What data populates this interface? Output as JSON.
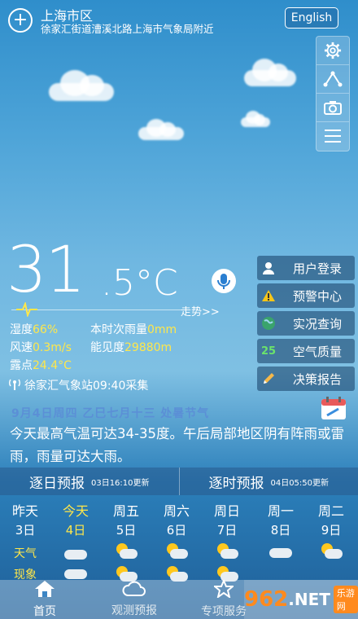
{
  "header": {
    "city": "上海市区",
    "address": "徐家汇街道漕溪北路上海市气象局附近",
    "language_button": "English"
  },
  "toolbar": {
    "icons": [
      "gear-icon",
      "share-icon",
      "camera-icon",
      "menu-icon"
    ]
  },
  "current": {
    "temp_int": "31",
    "temp_dec": ".5°C",
    "trend_label": "走势>>",
    "humidity_label": "湿度",
    "humidity_value": "66%",
    "rain_label": "本时次雨量",
    "rain_value": "0mm",
    "wind_label": "风速",
    "wind_value": "0.3m/s",
    "visibility_label": "能见度",
    "visibility_value": "29880m",
    "dew_label": "露点",
    "dew_value": "24.4°C",
    "station": "徐家汇气象站09:40采集"
  },
  "side_menu": [
    {
      "label": "用户登录",
      "icon": "user-icon"
    },
    {
      "label": "预警中心",
      "icon": "warning-icon"
    },
    {
      "label": "实况查询",
      "icon": "globe-icon"
    },
    {
      "label": "空气质量",
      "icon": "aqi-badge",
      "badge": "25"
    },
    {
      "label": "决策报告",
      "icon": "pencil-icon"
    }
  ],
  "date_line": "9月4日周四  乙巳七月十三  处暑节气",
  "forecast_text": "今天最高气温可达34-35度。午后局部地区阴有阵雨或雷雨，雨量可达大雨。",
  "tabs": [
    {
      "title": "逐日预报",
      "sub": "03日16:10更新"
    },
    {
      "title": "逐时预报",
      "sub": "04日05:50更新"
    }
  ],
  "days": [
    {
      "weekday": "昨天",
      "date": "3日"
    },
    {
      "weekday": "今天",
      "date": "4日"
    },
    {
      "weekday": "周五",
      "date": "5日"
    },
    {
      "weekday": "周六",
      "date": "6日"
    },
    {
      "weekday": "周日",
      "date": "7日"
    },
    {
      "weekday": "周一",
      "date": "8日"
    },
    {
      "weekday": "周二",
      "date": "9日"
    }
  ],
  "weather_label_1": "天气",
  "weather_label_2": "现象",
  "bottom_nav": [
    {
      "label": "首页",
      "icon": "home-icon"
    },
    {
      "label": "观测预报",
      "icon": "cloud-icon"
    },
    {
      "label": "专项服务",
      "icon": "star-icon"
    }
  ],
  "watermark": {
    "num": "962",
    "dot": ".NET",
    "sub": "乐游网"
  }
}
